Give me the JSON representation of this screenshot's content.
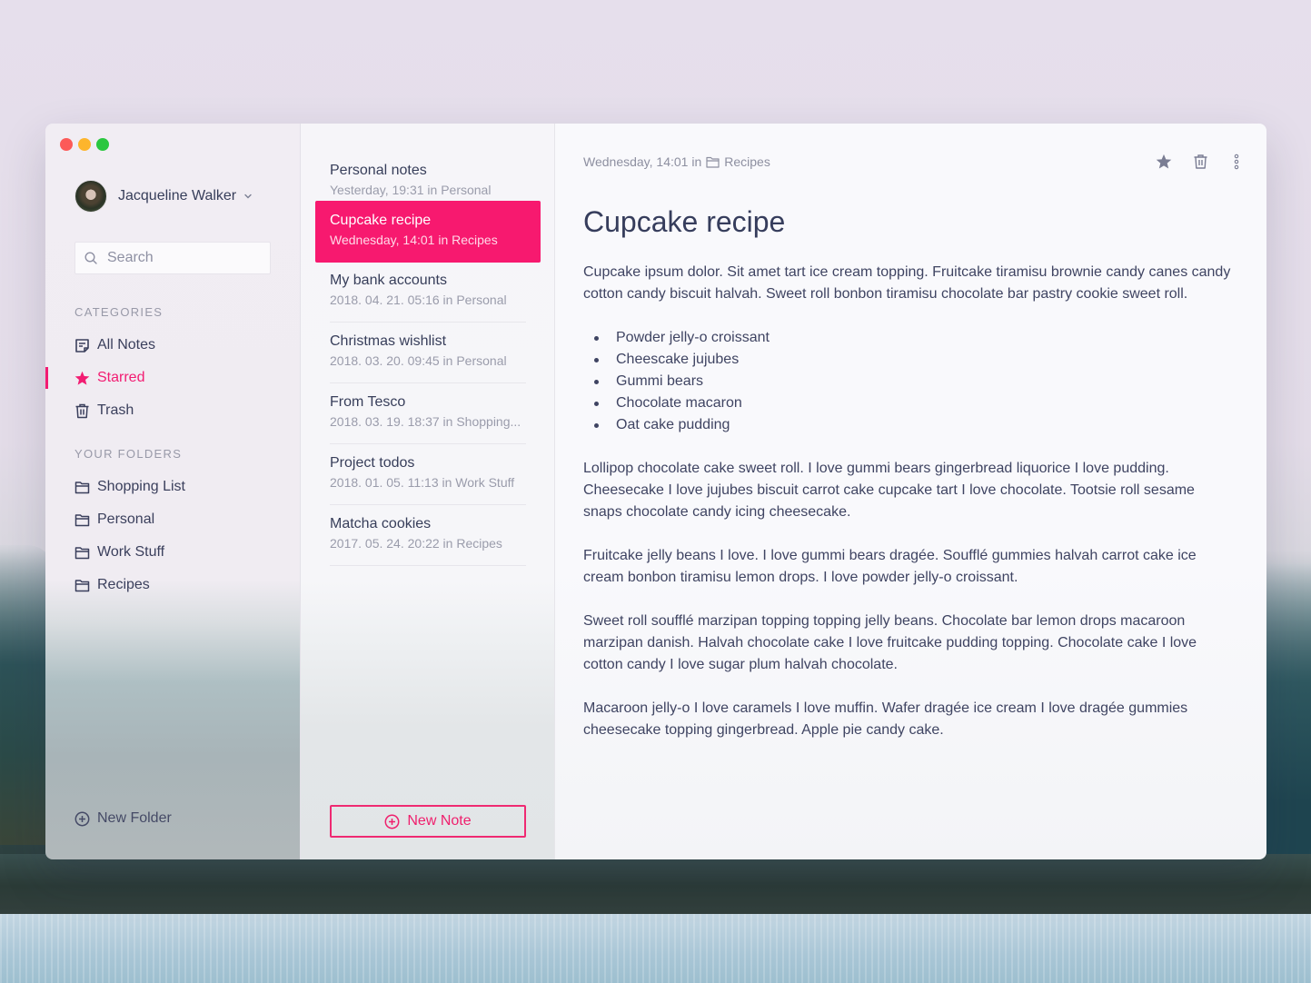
{
  "window": {
    "controls": [
      "close",
      "minimize",
      "maximize"
    ]
  },
  "user": {
    "name": "Jacqueline Walker"
  },
  "search": {
    "placeholder": "Search",
    "value": ""
  },
  "categories": {
    "title": "CATEGORIES",
    "items": [
      {
        "label": "All Notes",
        "icon": "note-icon",
        "active": false
      },
      {
        "label": "Starred",
        "icon": "star-icon",
        "active": true
      },
      {
        "label": "Trash",
        "icon": "trash-icon",
        "active": false
      }
    ]
  },
  "folders": {
    "title": "YOUR FOLDERS",
    "items": [
      {
        "label": "Shopping List",
        "icon": "folder-icon"
      },
      {
        "label": "Personal",
        "icon": "folder-icon"
      },
      {
        "label": "Work Stuff",
        "icon": "folder-icon"
      },
      {
        "label": "Recipes",
        "icon": "folder-icon"
      }
    ],
    "new_folder_label": "New Folder"
  },
  "notes": {
    "items": [
      {
        "title": "Personal notes",
        "meta": "Yesterday, 19:31 in Personal",
        "selected": false
      },
      {
        "title": "Cupcake recipe",
        "meta": "Wednesday, 14:01 in Recipes",
        "selected": true
      },
      {
        "title": "My bank accounts",
        "meta": "2018. 04. 21. 05:16 in Personal",
        "selected": false
      },
      {
        "title": "Christmas wishlist",
        "meta": "2018. 03. 20. 09:45 in Personal",
        "selected": false
      },
      {
        "title": "From Tesco",
        "meta": "2018. 03. 19. 18:37 in Shopping...",
        "selected": false
      },
      {
        "title": "Project todos",
        "meta": "2018. 01. 05. 11:13 in Work Stuff",
        "selected": false
      },
      {
        "title": "Matcha cookies",
        "meta": "2017. 05. 24. 20:22 in Recipes",
        "selected": false
      }
    ],
    "new_note_label": "New Note"
  },
  "editor": {
    "meta_prefix": "Wednesday, 14:01 in",
    "folder": "Recipes",
    "title": "Cupcake recipe",
    "intro": "Cupcake ipsum dolor. Sit amet tart ice cream topping. Fruitcake tiramisu brownie candy canes candy cotton candy biscuit halvah. Sweet roll bonbon tiramisu chocolate bar pastry cookie sweet roll.",
    "list": [
      "Powder jelly-o croissant",
      "Cheescake jujubes",
      "Gummi bears",
      "Chocolate macaron",
      "Oat cake pudding"
    ],
    "paragraphs": [
      "Lollipop chocolate cake sweet roll. I love gummi bears gingerbread liquorice I love pudding. Cheesecake I love jujubes biscuit carrot cake cupcake tart I love chocolate. Tootsie roll sesame snaps chocolate candy icing cheesecake.",
      "Fruitcake jelly beans I love. I love gummi bears dragée. Soufflé gummies halvah carrot cake ice cream bonbon tiramisu lemon drops. I love powder jelly-o croissant.",
      "Sweet roll soufflé marzipan topping topping jelly beans. Chocolate bar lemon drops macaroon marzipan danish. Halvah chocolate cake I love fruitcake pudding topping. Chocolate cake I love cotton candy I love sugar plum halvah chocolate.",
      "Macaroon jelly-o I love caramels I love muffin. Wafer dragée ice cream I love dragée gummies cheesecake topping gingerbread. Apple pie candy cake."
    ],
    "actions": [
      "star-icon",
      "trash-icon",
      "more-icon"
    ]
  },
  "colors": {
    "accent": "#f7196f",
    "text": "#373e5a",
    "muted": "#9a9cab"
  }
}
